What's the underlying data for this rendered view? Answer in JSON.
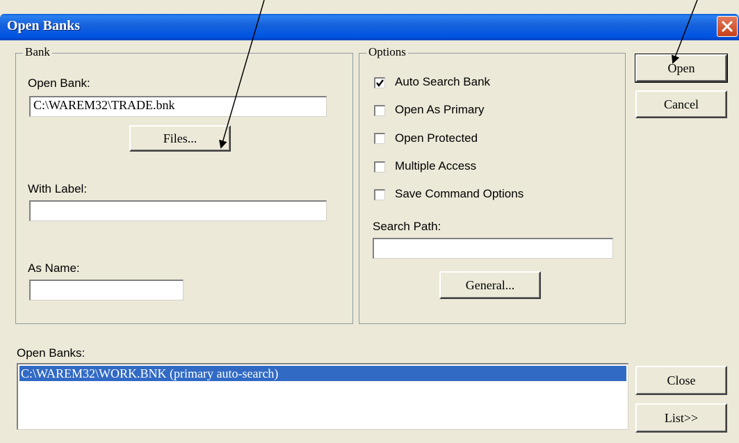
{
  "window": {
    "title": "Open Banks",
    "close_icon": "close-icon"
  },
  "bank_group": {
    "title": "Bank",
    "open_bank_label": "Open Bank:",
    "open_bank_value": "C:\\WAREM32\\TRADE.bnk",
    "files_button": "Files...",
    "with_label_label": "With Label:",
    "with_label_value": "",
    "as_name_label": "As Name:",
    "as_name_value": ""
  },
  "options_group": {
    "title": "Options",
    "checkboxes": [
      {
        "label": "Auto Search Bank",
        "checked": true
      },
      {
        "label": "Open As Primary",
        "checked": false
      },
      {
        "label": "Open Protected",
        "checked": false
      },
      {
        "label": "Multiple Access",
        "checked": false
      },
      {
        "label": "Save Command Options",
        "checked": false
      }
    ],
    "search_path_label": "Search Path:",
    "search_path_value": "",
    "general_button": "General..."
  },
  "buttons": {
    "open": "Open",
    "cancel": "Cancel",
    "close": "Close",
    "list": "List>>"
  },
  "open_banks": {
    "label": "Open Banks:",
    "items": [
      "C:\\WAREM32\\WORK.BNK (primary auto-search)"
    ]
  },
  "colors": {
    "title_bar": "#0054e3",
    "dialog_bg": "#ece9d8",
    "selection": "#316ac5"
  }
}
